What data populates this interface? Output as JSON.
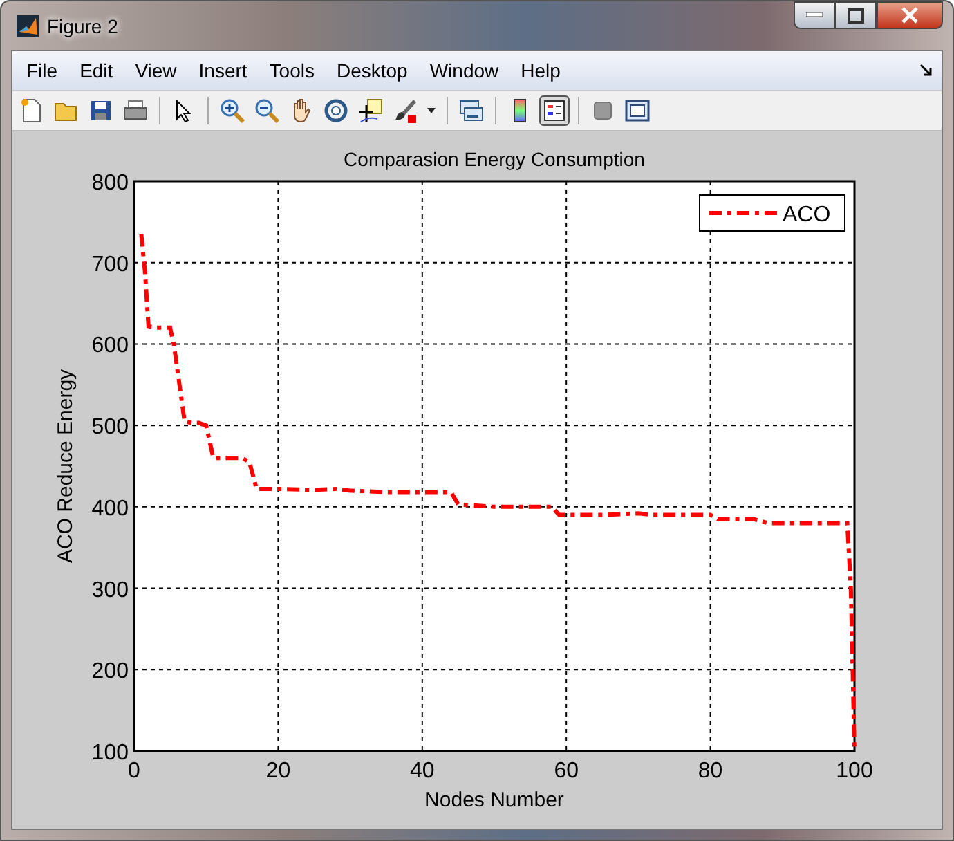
{
  "window": {
    "title": "Figure 2"
  },
  "menu": [
    {
      "label": "File"
    },
    {
      "label": "Edit"
    },
    {
      "label": "View"
    },
    {
      "label": "Insert"
    },
    {
      "label": "Tools"
    },
    {
      "label": "Desktop"
    },
    {
      "label": "Window"
    },
    {
      "label": "Help"
    }
  ],
  "toolbar": [
    {
      "kind": "new",
      "on": false
    },
    {
      "kind": "open",
      "on": false
    },
    {
      "kind": "save",
      "on": false
    },
    {
      "kind": "print",
      "on": false
    },
    {
      "kind": "separator"
    },
    {
      "kind": "pointer",
      "on": false
    },
    {
      "kind": "separator"
    },
    {
      "kind": "zoom-in",
      "on": false
    },
    {
      "kind": "zoom-out",
      "on": false
    },
    {
      "kind": "hand",
      "on": false
    },
    {
      "kind": "rotate",
      "on": false
    },
    {
      "kind": "cursor",
      "on": false
    },
    {
      "kind": "brush",
      "on": false
    },
    {
      "kind": "caret",
      "on": false
    },
    {
      "kind": "separator"
    },
    {
      "kind": "link",
      "on": false
    },
    {
      "kind": "separator"
    },
    {
      "kind": "colorbar",
      "on": false
    },
    {
      "kind": "legend",
      "on": true
    },
    {
      "kind": "separator"
    },
    {
      "kind": "square",
      "on": false
    },
    {
      "kind": "panel",
      "on": false
    }
  ],
  "chart_data": {
    "type": "line",
    "grid": true,
    "title": "Comparasion Energy Consumption",
    "xlabel": "Nodes Number",
    "ylabel": "ACO Reduce Energy",
    "xlim": [
      0,
      100
    ],
    "ylim": [
      100,
      800
    ],
    "xticks": [
      0,
      20,
      40,
      60,
      80,
      100
    ],
    "yticks": [
      100,
      200,
      300,
      400,
      500,
      600,
      700,
      800
    ],
    "x": [
      1,
      1.5,
      2,
      3,
      5,
      5.5,
      7,
      8,
      9,
      10,
      11,
      13,
      15,
      16,
      17,
      20,
      25,
      28,
      30,
      35,
      40,
      44,
      45,
      50,
      58,
      59,
      65,
      70,
      72,
      80,
      81,
      86,
      88,
      95,
      99,
      99.5,
      100
    ],
    "series": [
      {
        "name": "ACO",
        "color": "#ff0000",
        "line_style": "dashdot",
        "values": [
          735,
          690,
          622,
          620,
          620,
          600,
          505,
          503,
          503,
          500,
          460,
          460,
          460,
          455,
          422,
          422,
          421,
          422,
          420,
          418,
          418,
          418,
          403,
          400,
          400,
          390,
          390,
          392,
          390,
          390,
          385,
          385,
          380,
          380,
          380,
          300,
          100
        ]
      }
    ]
  }
}
